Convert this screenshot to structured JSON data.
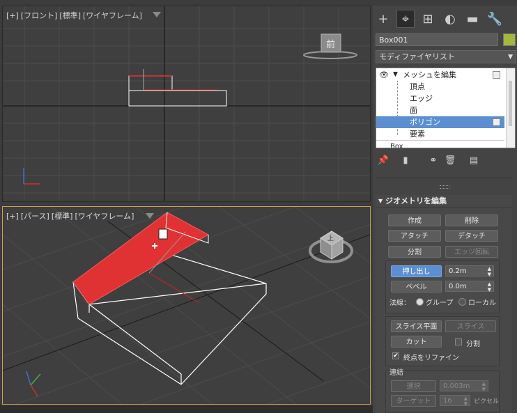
{
  "viewports": {
    "front": {
      "plus": "[+]",
      "name": "[フロント]",
      "shading": "[標準]",
      "mode": "[ワイヤフレーム]",
      "cube_label": "前"
    },
    "persp": {
      "plus": "[+]",
      "name": "[パース]",
      "shading": "[標準]",
      "mode": "[ワイヤフレーム]",
      "cube_label": "上"
    }
  },
  "command_panel": {
    "tabs": [
      {
        "icon": "create-plus-icon",
        "glyph": "+"
      },
      {
        "icon": "modify-icon",
        "glyph": "⌖"
      },
      {
        "icon": "hierarchy-icon",
        "glyph": "⊞"
      },
      {
        "icon": "motion-icon",
        "glyph": "◐"
      },
      {
        "icon": "display-icon",
        "glyph": "▬"
      },
      {
        "icon": "utilities-icon",
        "glyph": "🔧"
      }
    ],
    "object_name": "Box001",
    "object_color": "#a6b83a",
    "modifier_list": "モディファイヤリスト",
    "stack": {
      "modifier": "メッシュを編集",
      "subobjects": [
        "頂点",
        "エッジ",
        "面",
        "ポリゴン",
        "要素"
      ],
      "selected": "ポリゴン",
      "base": "Box"
    }
  },
  "edit_geometry": {
    "title": "ジオメトリを編集",
    "create": "作成",
    "delete": "削除",
    "attach": "アタッチ",
    "detach": "デタッチ",
    "divide": "分割",
    "turn_edge": "エッジ回転",
    "extrude": "押し出し",
    "extrude_value": "0.2m",
    "bevel": "ベベル",
    "bevel_value": "0.0m",
    "normal_label": "法線：",
    "group": "グループ",
    "local": "ローカル",
    "slice_plane": "スライス平面",
    "slice": "スライス",
    "cut": "カット",
    "split": "分割",
    "refine_ends": "終点をリファイン",
    "weld_title": "連結",
    "weld_selected": "選択",
    "weld_selected_value": "0.003m",
    "weld_target": "ターゲット",
    "weld_target_value": "16",
    "pixels": "ピクセル"
  }
}
